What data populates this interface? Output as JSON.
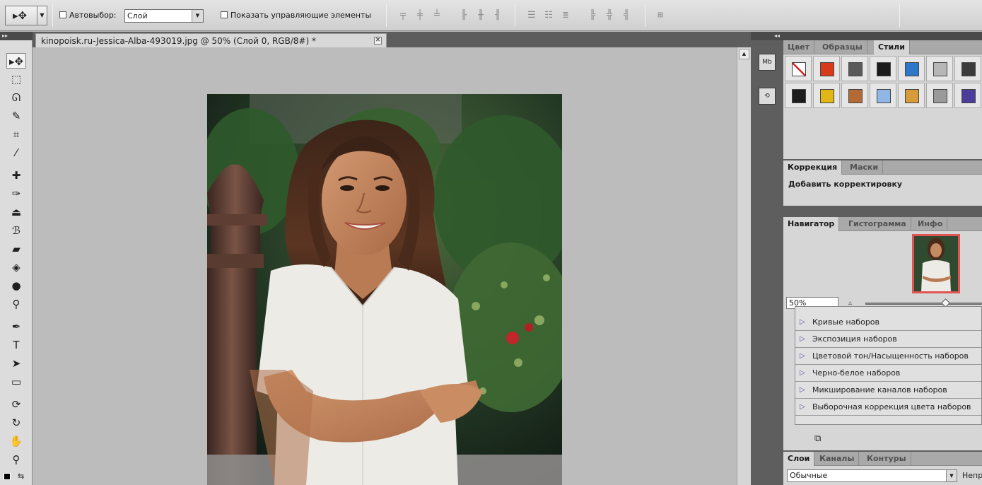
{
  "options_bar": {
    "tool_preset_icon": "move-icon",
    "autoselect_label": "Автовыбор:",
    "autoselect_value": "Слой",
    "show_controls_label": "Показать управляющие элементы"
  },
  "document": {
    "tab_title": "kinopoisk.ru-Jessica-Alba-493019.jpg @ 50% (Слой 0, RGB/8#) *",
    "close_glyph": "✕"
  },
  "dock": {
    "mini_bridge_label": "Mb",
    "history_label": "⟲"
  },
  "panels": {
    "swatches_group": {
      "tabs": [
        "Цвет",
        "Образцы",
        "Стили"
      ],
      "active_tab": "Стили",
      "styles": [
        "#ffffff",
        "#d73a1b",
        "#5a5a5a",
        "#1b1b1b",
        "#2f76c8",
        "#b7b7b7",
        "#3b3b3b",
        "#1c1c1c",
        "#e2b616",
        "#b46a35",
        "#8fb6e5",
        "#d79b3c",
        "#9a9a9a",
        "#4b3b9a"
      ]
    },
    "adjustments_group": {
      "tabs": [
        "Коррекция",
        "Маски"
      ],
      "active_tab": "Коррекция",
      "heading": "Добавить корректировку"
    },
    "navigator_group": {
      "tabs": [
        "Навигатор",
        "Гистограмма",
        "Инфо"
      ],
      "active_tab": "Навигатор",
      "zoom": "50%",
      "zoom_fraction": 0.68
    },
    "presets": [
      "Кривые наборов",
      "Экспозиция наборов",
      "Цветовой тон/Насыщенность наборов",
      "Черно-белое наборов",
      "Микширование каналов наборов",
      "Выборочная коррекция цвета наборов"
    ],
    "layers_group": {
      "tabs": [
        "Слои",
        "Каналы",
        "Контуры"
      ],
      "active_tab": "Слои",
      "blend_mode": "Обычные",
      "opacity_label": "Непр"
    }
  },
  "colors": {
    "accent_navigator_frame": "#e25454",
    "dark_chrome": "#5e5e5e",
    "panel_bg": "#d6d6d6"
  }
}
